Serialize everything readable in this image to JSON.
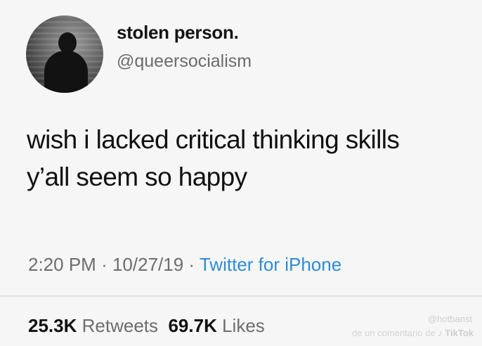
{
  "user": {
    "display_name": "stolen person.",
    "handle": "@queersocialism"
  },
  "tweet": {
    "lines": [
      "wish i lacked critical thinking skills",
      "y’all seem so happy"
    ],
    "time": "2:20 PM",
    "separator": "·",
    "date": "10/27/19",
    "source": "Twitter for iPhone"
  },
  "stats": {
    "retweets_count": "25.3K",
    "retweets_label": "Retweets",
    "likes_count": "69.7K",
    "likes_label": "Likes"
  },
  "watermark": {
    "top": "@hotbanst",
    "bottom_prefix": "de un comentario de",
    "bottom_brand": "♪ TikTok"
  },
  "colors": {
    "background": "#f6f6f6",
    "source_link": "#2f8bd6",
    "secondary_text": "#6d6d6d"
  }
}
